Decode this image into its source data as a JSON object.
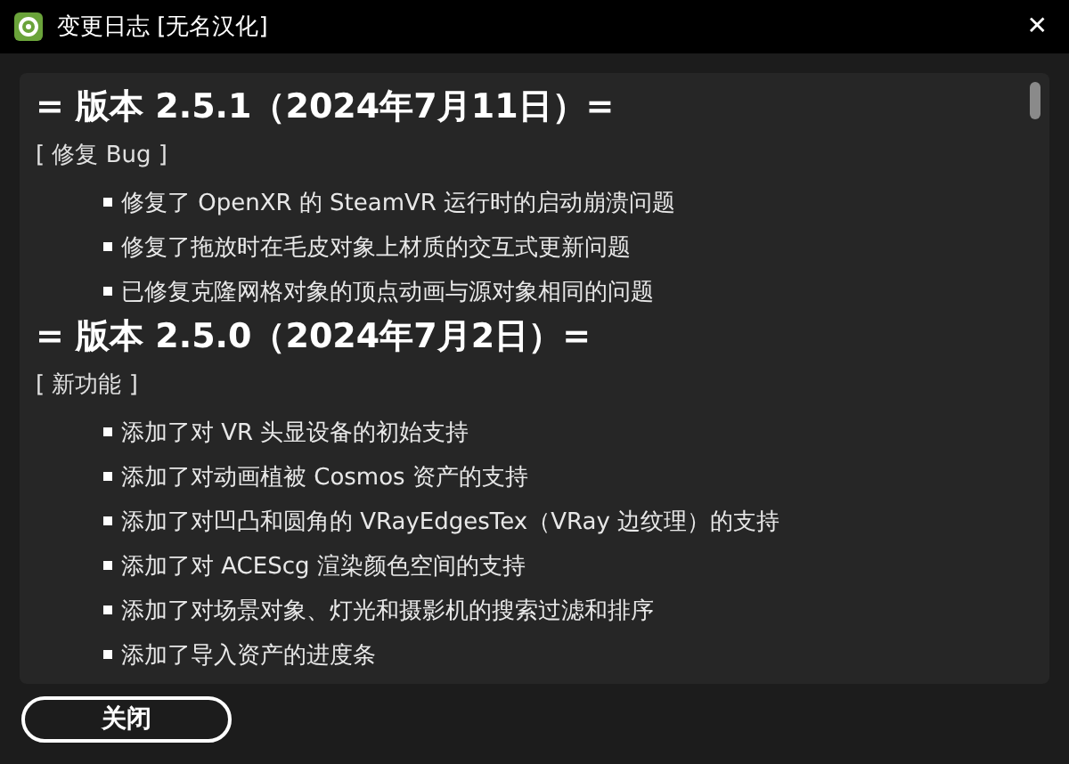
{
  "window": {
    "title": "变更日志 [无名汉化]",
    "close": "✕"
  },
  "sections": [
    {
      "heading": "= 版本 2.5.1（2024年7月11日）=",
      "category": "[ 修复 Bug ]",
      "items": [
        "修复了 OpenXR 的 SteamVR 运行时的启动崩溃问题",
        "修复了拖放时在毛皮对象上材质的交互式更新问题",
        "已修复克隆网格对象的顶点动画与源对象相同的问题"
      ]
    },
    {
      "heading": "= 版本 2.5.0（2024年7月2日）=",
      "category": "[ 新功能 ]",
      "items": [
        "添加了对 VR 头显设备的初始支持",
        "添加了对动画植被 Cosmos 资产的支持",
        "添加了对凹凸和圆角的 VRayEdgesTex（VRay 边纹理）的支持",
        "添加了对 ACEScg 渲染颜色空间的支持",
        "添加了对场景对象、灯光和摄影机的搜索过滤和排序",
        "添加了导入资产的进度条"
      ]
    }
  ],
  "buttons": [
    "关闭"
  ]
}
